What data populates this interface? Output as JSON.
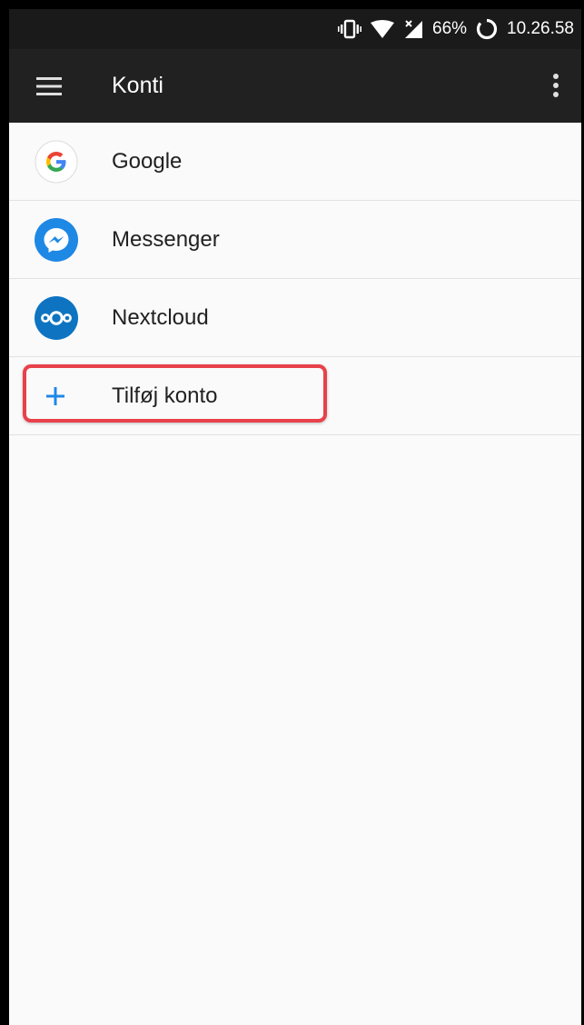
{
  "status_bar": {
    "battery": "66%",
    "time": "10.26.58",
    "icons": [
      "vibrate-icon",
      "wifi-icon",
      "signal-icon",
      "battery-icon"
    ]
  },
  "toolbar": {
    "title": "Konti",
    "menu_icon": "hamburger-menu-icon",
    "overflow_icon": "more-vert-icon"
  },
  "accounts": [
    {
      "label": "Google",
      "icon": "google-icon"
    },
    {
      "label": "Messenger",
      "icon": "messenger-icon"
    },
    {
      "label": "Nextcloud",
      "icon": "nextcloud-icon"
    }
  ],
  "add_account": {
    "label": "Tilføj konto",
    "icon": "plus-icon",
    "highlighted": true
  },
  "colors": {
    "toolbar": "#212121",
    "status_bar": "#1a1a1a",
    "background": "#fafafa",
    "accent": "#1e88e5",
    "highlight": "#e8414a"
  }
}
